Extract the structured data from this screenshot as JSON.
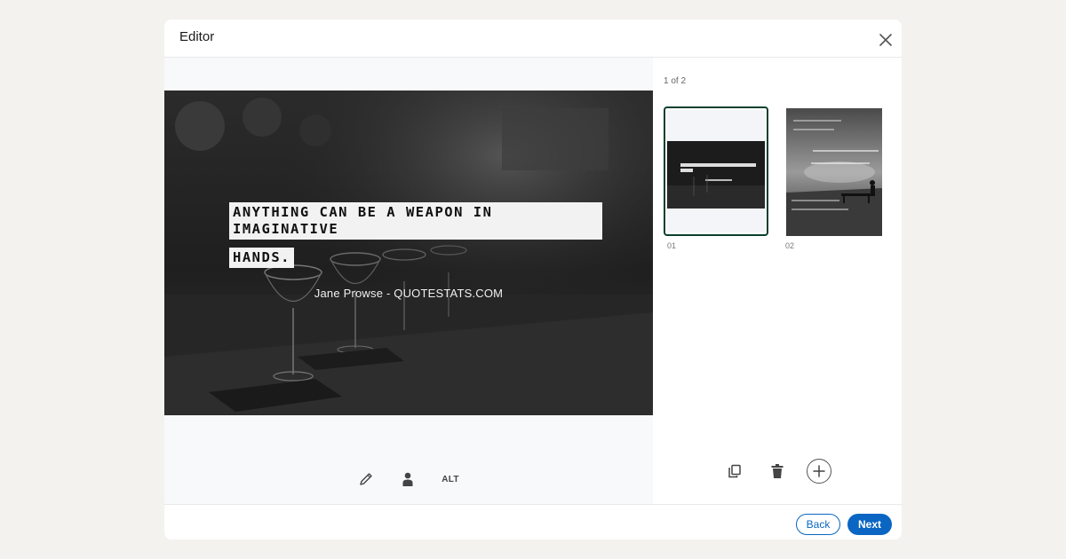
{
  "header": {
    "title": "Editor"
  },
  "preview": {
    "quote_lines": [
      "ANYTHING CAN BE A WEAPON IN IMAGINATIVE",
      "HANDS."
    ],
    "author": "Jane Prowse - QUOTESTATS.COM"
  },
  "editor_tools": {
    "edit_icon": "pencil-icon",
    "tag_icon": "person-icon",
    "alt_label": "ALT"
  },
  "side_panel": {
    "page_count": "1 of 2",
    "thumbnails": [
      {
        "label": "01",
        "selected": true
      },
      {
        "label": "02",
        "selected": false
      }
    ],
    "tools": [
      "duplicate-icon",
      "trash-icon",
      "add-icon"
    ]
  },
  "footer": {
    "back_label": "Back",
    "next_label": "Next"
  },
  "colors": {
    "accent": "#0a66c2",
    "selected_border": "#0b3f2e",
    "page_background": "#f3f2ef"
  }
}
